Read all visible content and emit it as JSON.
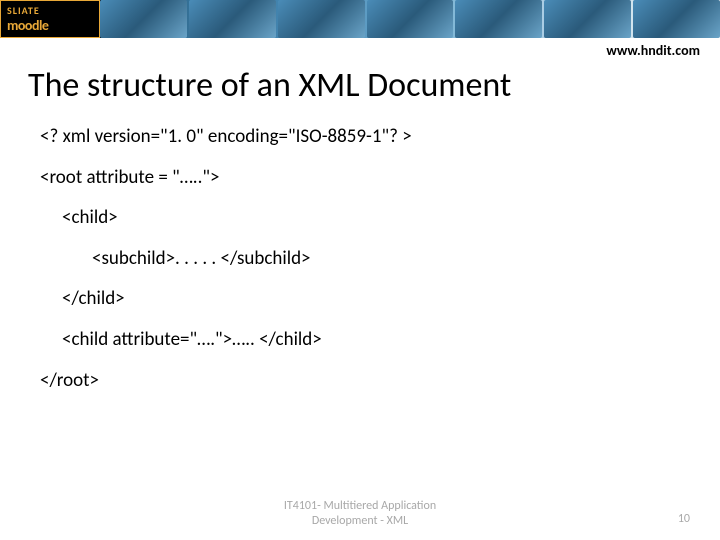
{
  "header": {
    "logo_top": "SLIATE",
    "logo_bottom": "moodle"
  },
  "url": "www.hndit.com",
  "title": "The structure of an XML Document",
  "code": {
    "line1": "<? xml version=\"1. 0\" encoding=\"ISO-8859-1\"? >",
    "line2": "<root  attribute = \"…..\">",
    "line3": "<child>",
    "line4": "<subchild>. . . . . </subchild>",
    "line5": "</child>",
    "line6": "<child attribute=\"….\">….. </child>",
    "line7": "</root>"
  },
  "footer": {
    "course_line1": "IT4101- Multitiered Application",
    "course_line2": "Development - XML",
    "page_number": "10"
  }
}
